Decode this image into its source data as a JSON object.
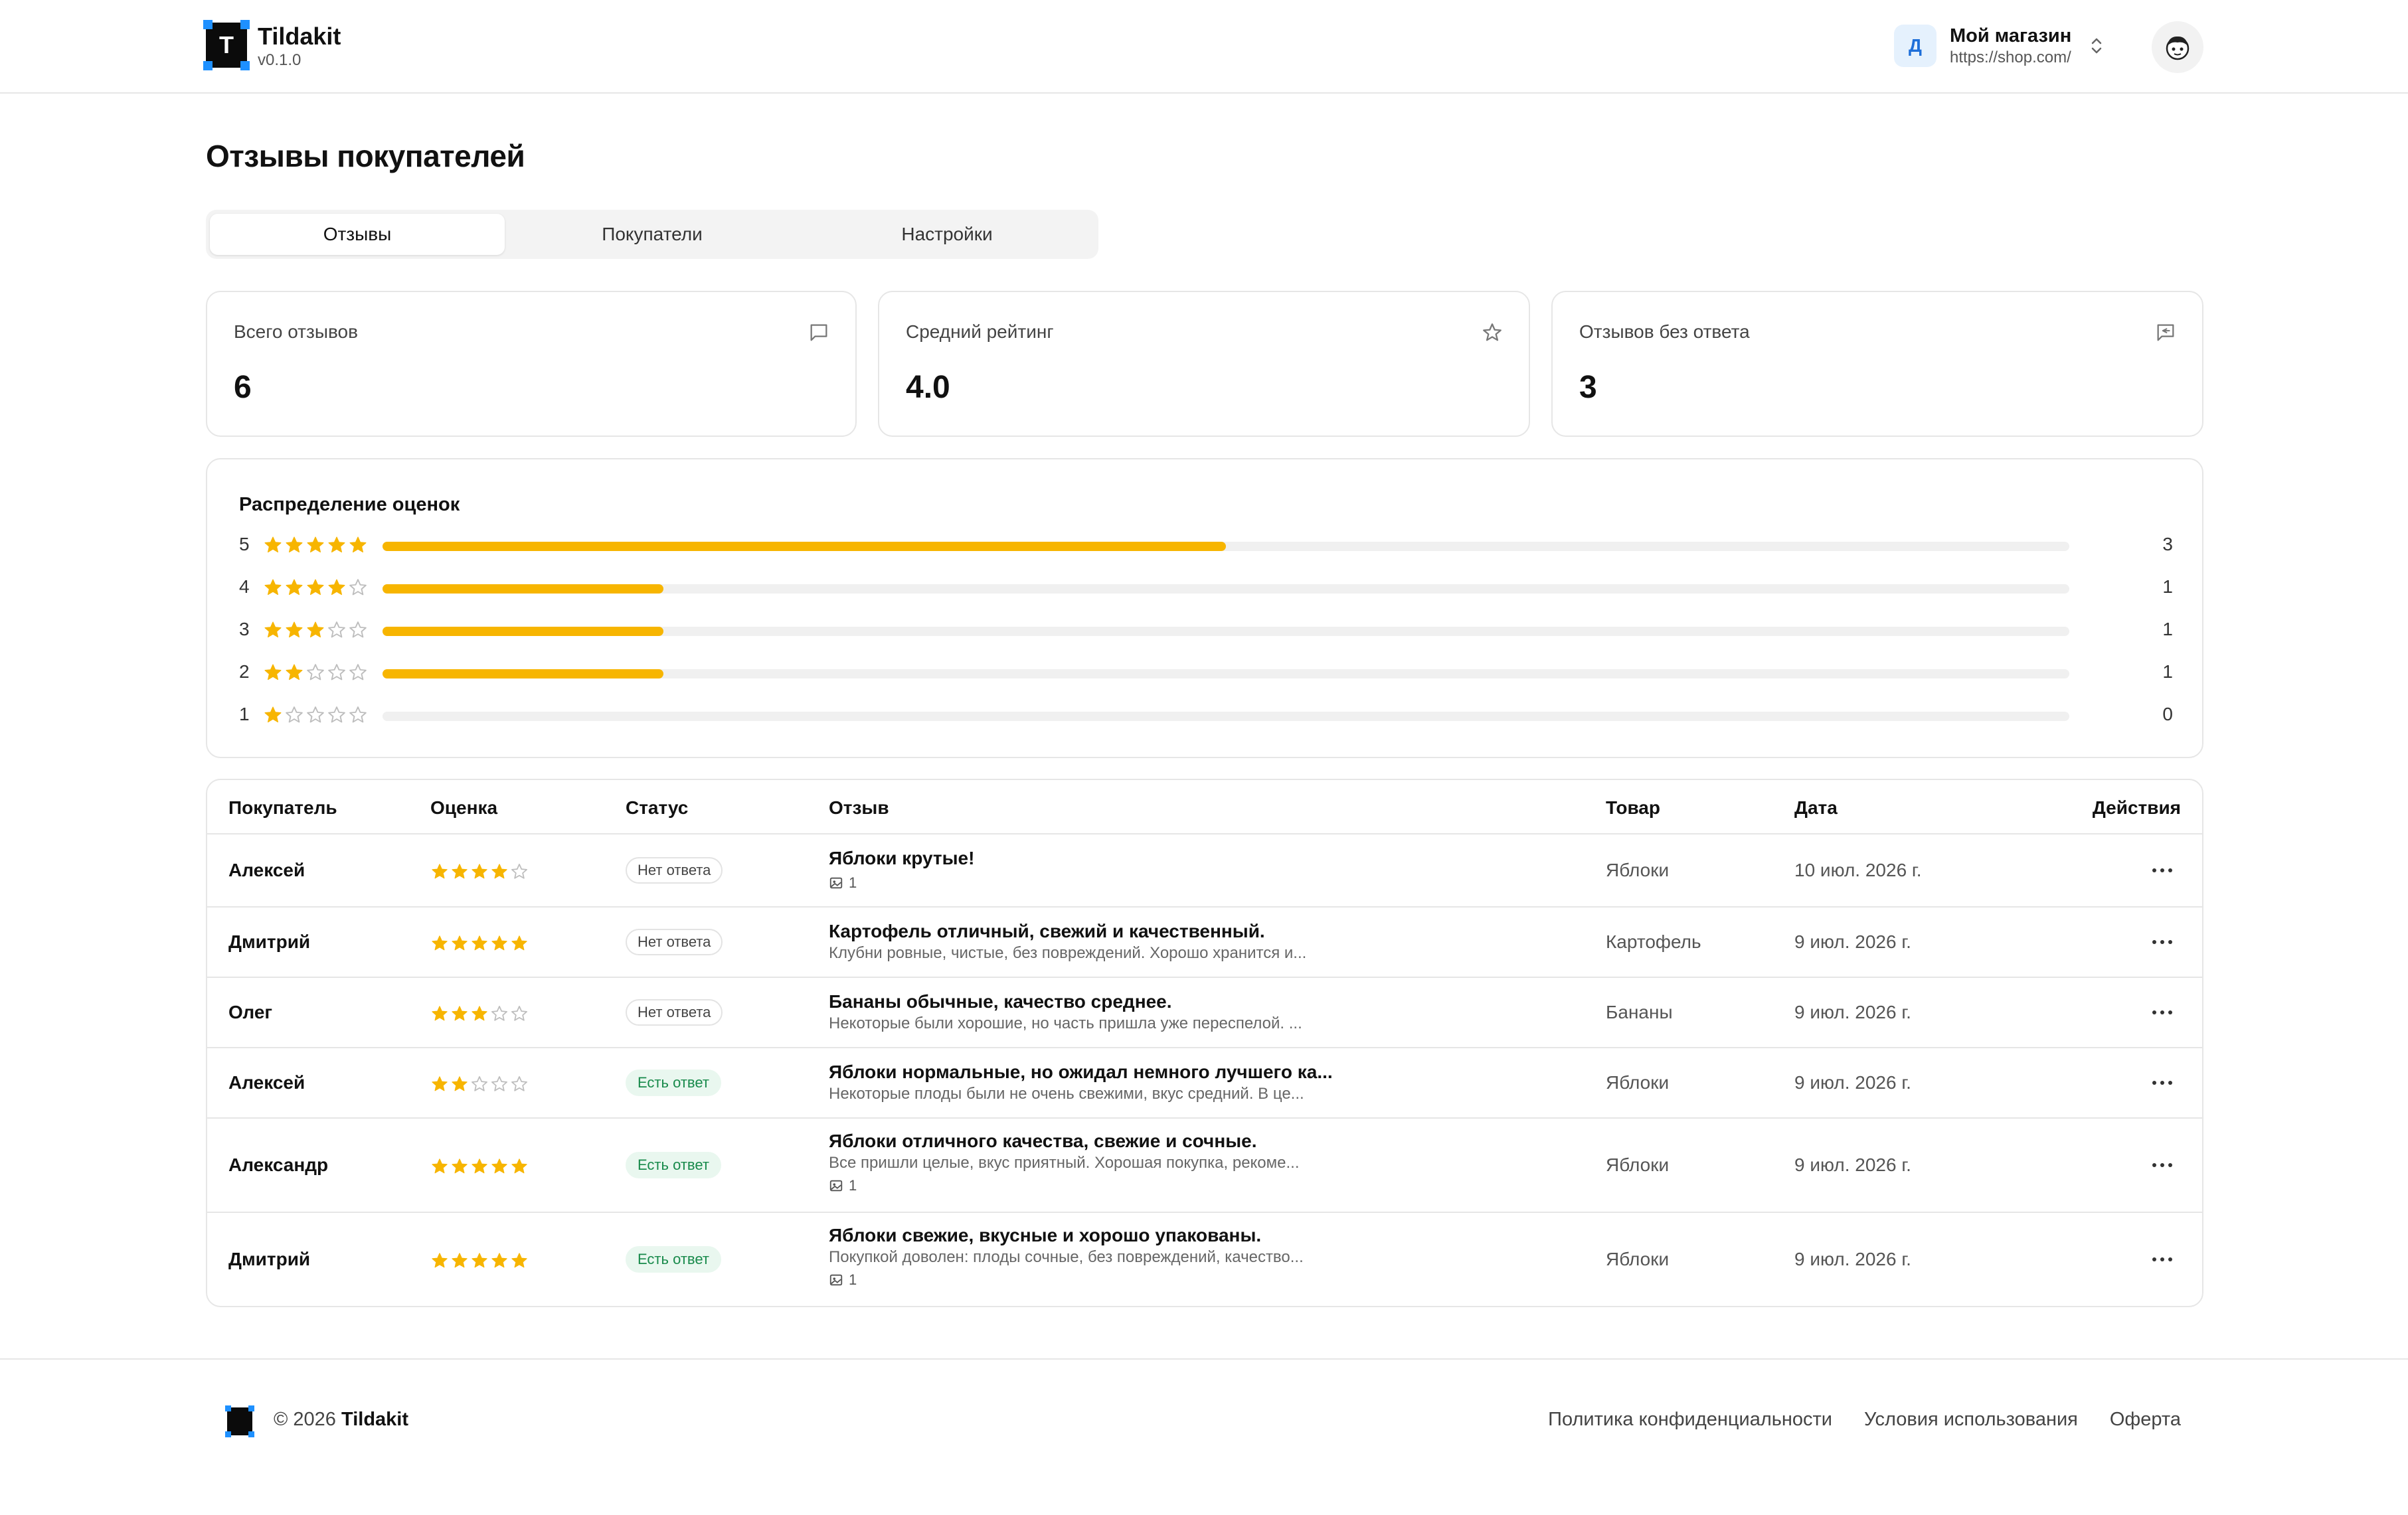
{
  "header": {
    "brand_letter": "T",
    "brand_name": "Tildakit",
    "version": "v0.1.0",
    "store_initial": "Д",
    "store_name": "Мой магазин",
    "store_url": "https://shop.com/"
  },
  "page_title": "Отзывы покупателей",
  "tabs": [
    {
      "label": "Отзывы",
      "active": true
    },
    {
      "label": "Покупатели",
      "active": false
    },
    {
      "label": "Настройки",
      "active": false
    }
  ],
  "stats": [
    {
      "label": "Всего отзывов",
      "value": "6",
      "icon": "message-square-icon"
    },
    {
      "label": "Средний рейтинг",
      "value": "4.0",
      "icon": "star-icon"
    },
    {
      "label": "Отзывов без ответа",
      "value": "3",
      "icon": "message-reply-icon"
    }
  ],
  "distribution": {
    "title": "Распределение оценок",
    "max": 6,
    "rows": [
      {
        "rating": "5",
        "stars": 5,
        "count": "3",
        "value": 3
      },
      {
        "rating": "4",
        "stars": 4,
        "count": "1",
        "value": 1
      },
      {
        "rating": "3",
        "stars": 3,
        "count": "1",
        "value": 1
      },
      {
        "rating": "2",
        "stars": 2,
        "count": "1",
        "value": 1
      },
      {
        "rating": "1",
        "stars": 1,
        "count": "0",
        "value": 0
      }
    ]
  },
  "table": {
    "headers": {
      "customer": "Покупатель",
      "rating": "Оценка",
      "status": "Статус",
      "review": "Отзыв",
      "product": "Товар",
      "date": "Дата",
      "actions": "Действия"
    },
    "rows": [
      {
        "customer": "Алексей",
        "stars": 4,
        "status": "Нет ответа",
        "answered": false,
        "title": "Яблоки крутые!",
        "text": "",
        "photos": "1",
        "product": "Яблоки",
        "date": "10 июл. 2026 г."
      },
      {
        "customer": "Дмитрий",
        "stars": 5,
        "status": "Нет ответа",
        "answered": false,
        "title": "Картофель отличный, свежий и качественный.",
        "text": "Клубни ровные, чистые, без повреждений. Хорошо хранится и...",
        "photos": "",
        "product": "Картофель",
        "date": "9 июл. 2026 г."
      },
      {
        "customer": "Олег",
        "stars": 3,
        "status": "Нет ответа",
        "answered": false,
        "title": "Бананы обычные, качество среднее.",
        "text": "Некоторые были хорошие, но часть пришла уже переспелой. ...",
        "photos": "",
        "product": "Бананы",
        "date": "9 июл. 2026 г."
      },
      {
        "customer": "Алексей",
        "stars": 2,
        "status": "Есть ответ",
        "answered": true,
        "title": "Яблоки нормальные, но ожидал немного лучшего ка...",
        "text": "Некоторые плоды были не очень свежими, вкус средний. В це...",
        "photos": "",
        "product": "Яблоки",
        "date": "9 июл. 2026 г."
      },
      {
        "customer": "Александр",
        "stars": 5,
        "status": "Есть ответ",
        "answered": true,
        "title": "Яблоки отличного качества, свежие и сочные.",
        "text": "Все пришли целые, вкус приятный. Хорошая покупка, рекоме...",
        "photos": "1",
        "product": "Яблоки",
        "date": "9 июл. 2026 г."
      },
      {
        "customer": "Дмитрий",
        "stars": 5,
        "status": "Есть ответ",
        "answered": true,
        "title": "Яблоки свежие, вкусные и хорошо упакованы.",
        "text": "Покупкой доволен: плоды сочные, без повреждений, качество...",
        "photos": "1",
        "product": "Яблоки",
        "date": "9 июл. 2026 г."
      }
    ]
  },
  "footer": {
    "copyright_prefix": "© 2026",
    "copyright_brand": "Tildakit",
    "links": [
      "Политика конфиденциальности",
      "Условия использования",
      "Оферта"
    ]
  },
  "colors": {
    "accent_star": "#f7b500",
    "answered_badge": "#188a4b",
    "logo_corner": "#1e90ff"
  }
}
